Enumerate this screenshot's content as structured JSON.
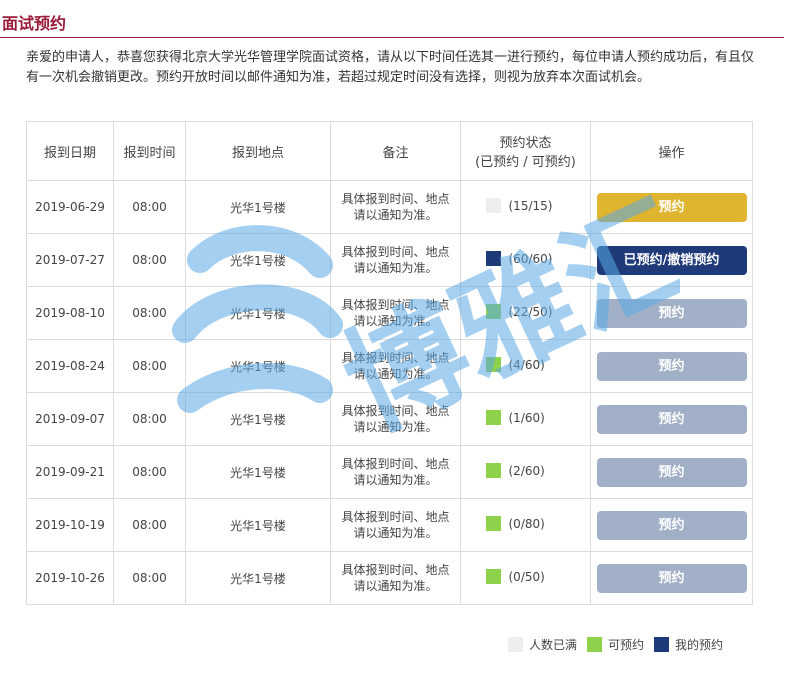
{
  "page_title": "面试预约",
  "intro_text": "亲爱的申请人，恭喜您获得北京大学光华管理学院面试资格，请从以下时间任选其一进行预约，每位申请人预约成功后，有且仅有一次机会撤销更改。预约开放时间以邮件通知为准，若超过规定时间没有选择，则视为放弃本次面试机会。",
  "table": {
    "headers": {
      "date": "报到日期",
      "time": "报到时间",
      "place": "报到地点",
      "note": "备注",
      "status_line1": "预约状态",
      "status_line2": "(已预约 / 可预约)",
      "action": "操作"
    },
    "rows": [
      {
        "date": "2019-06-29",
        "time": "08:00",
        "place": "光华1号楼",
        "note1": "具体报到时间、地点",
        "note2": "请以通知为准。",
        "count": "(15/15)",
        "state": "full",
        "action": "预约"
      },
      {
        "date": "2019-07-27",
        "time": "08:00",
        "place": "光华1号楼",
        "note1": "具体报到时间、地点",
        "note2": "请以通知为准。",
        "count": "(60/60)",
        "state": "mine",
        "action": "已预约/撤销预约"
      },
      {
        "date": "2019-08-10",
        "time": "08:00",
        "place": "光华1号楼",
        "note1": "具体报到时间、地点",
        "note2": "请以通知为准。",
        "count": "(22/50)",
        "state": "available",
        "action": "预约"
      },
      {
        "date": "2019-08-24",
        "time": "08:00",
        "place": "光华1号楼",
        "note1": "具体报到时间、地点",
        "note2": "请以通知为准。",
        "count": "(4/60)",
        "state": "available",
        "action": "预约"
      },
      {
        "date": "2019-09-07",
        "time": "08:00",
        "place": "光华1号楼",
        "note1": "具体报到时间、地点",
        "note2": "请以通知为准。",
        "count": "(1/60)",
        "state": "available",
        "action": "预约"
      },
      {
        "date": "2019-09-21",
        "time": "08:00",
        "place": "光华1号楼",
        "note1": "具体报到时间、地点",
        "note2": "请以通知为准。",
        "count": "(2/60)",
        "state": "available",
        "action": "预约"
      },
      {
        "date": "2019-10-19",
        "time": "08:00",
        "place": "光华1号楼",
        "note1": "具体报到时间、地点",
        "note2": "请以通知为准。",
        "count": "(0/80)",
        "state": "available",
        "action": "预约"
      },
      {
        "date": "2019-10-26",
        "time": "08:00",
        "place": "光华1号楼",
        "note1": "具体报到时间、地点",
        "note2": "请以通知为准。",
        "count": "(0/50)",
        "state": "available",
        "action": "预约"
      }
    ]
  },
  "legend": {
    "full": "人数已满",
    "available": "可预约",
    "mine": "我的预约"
  },
  "watermark_text": "博雅汇",
  "colors": {
    "brand": "#9b1b3a",
    "full": "#eeeeee",
    "available": "#8ed14b",
    "mine": "#1e3a78",
    "btn_gold": "#dfb42e",
    "btn_navy": "#1e3a78",
    "btn_disabled": "#a2b0c7"
  }
}
